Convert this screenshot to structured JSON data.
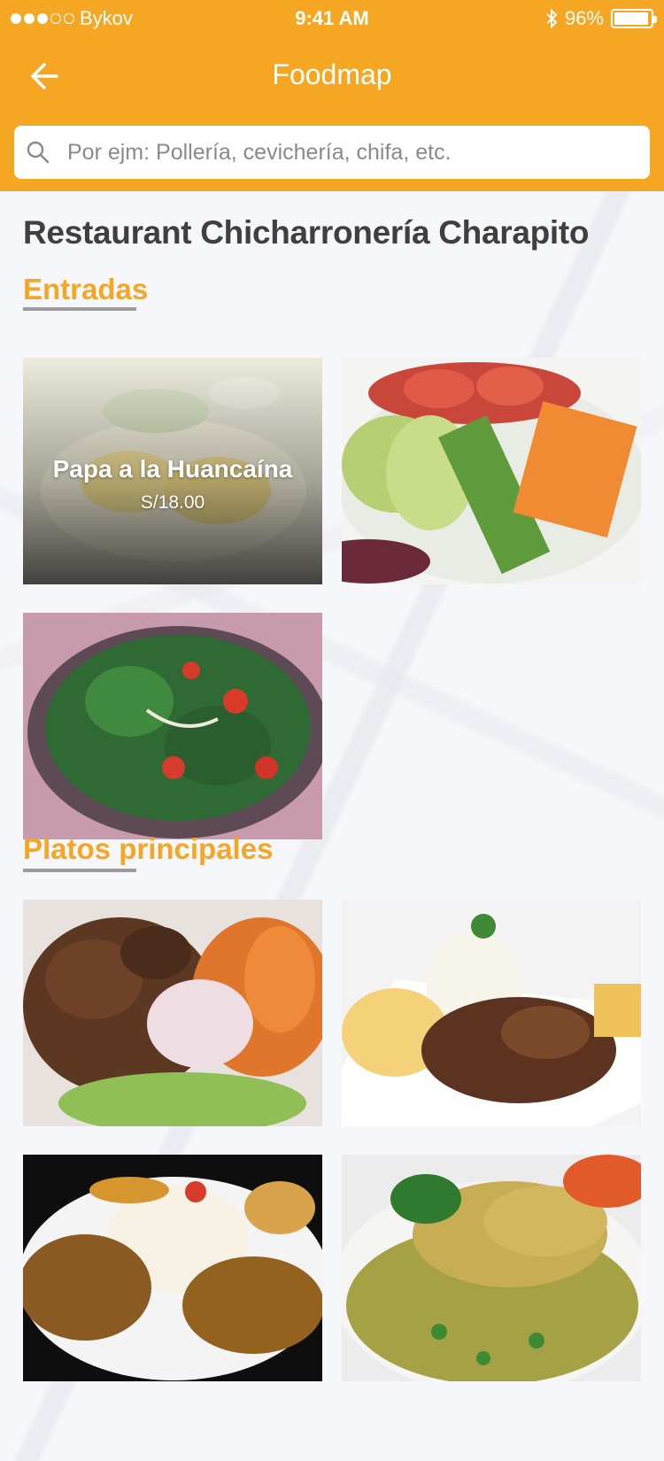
{
  "status_bar": {
    "carrier": "Bykov",
    "time": "9:41 AM",
    "battery": "96%",
    "battery_level": 0.96
  },
  "nav": {
    "title": "Foodmap"
  },
  "search": {
    "placeholder": "Por ejm: Pollería, cevichería, chifa, etc."
  },
  "restaurant": {
    "name": "Restaurant Chicharronería Charapito"
  },
  "sections": [
    {
      "title": "Entradas",
      "items": [
        {
          "name": "Papa a la Huancaína",
          "price": "S/18.00",
          "image": "papa-a-la-huancaina-photo"
        },
        {
          "image": "vegetable-salad-photo"
        },
        {
          "image": "spinach-salad-photo"
        }
      ]
    },
    {
      "title": "Platos principales",
      "items": [
        {
          "image": "chicharron-photo"
        },
        {
          "image": "lomo-saltado-photo"
        },
        {
          "image": "seco-de-pato-photo"
        },
        {
          "image": "arroz-con-pollo-photo"
        }
      ]
    }
  ],
  "colors": {
    "accent": "#f5a623",
    "title_text": "#3f3f3f",
    "underline": "#9b9b9b"
  }
}
